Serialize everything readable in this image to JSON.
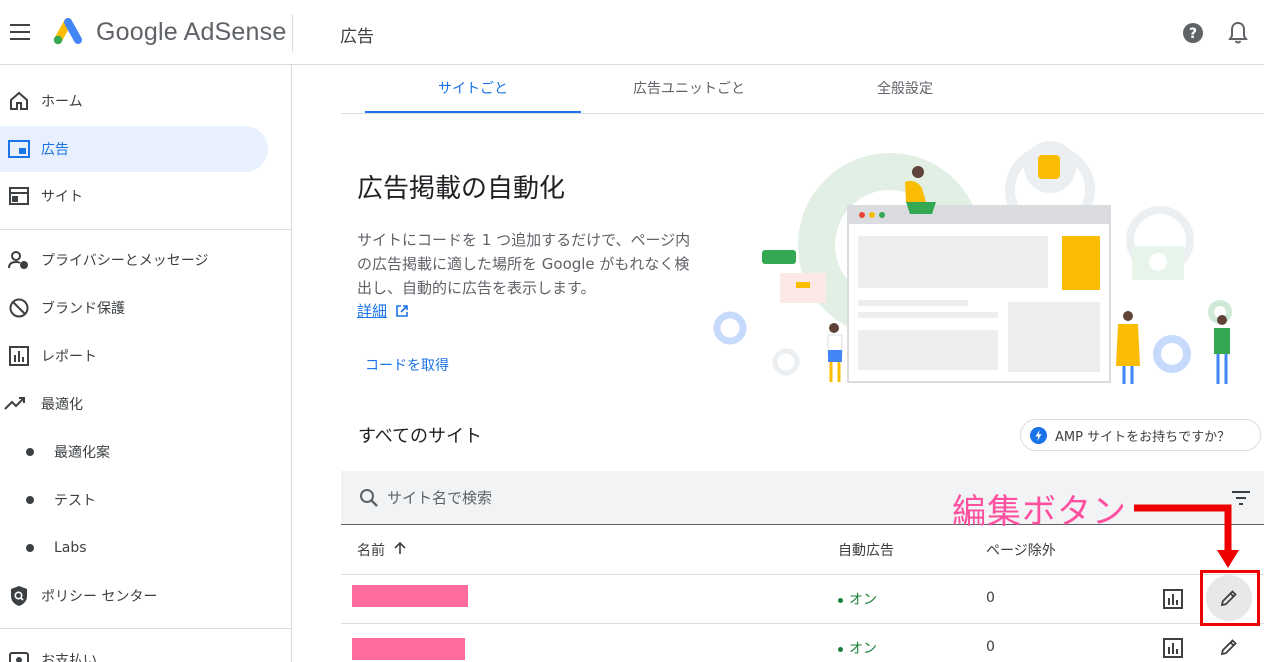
{
  "app": {
    "brand": "Google AdSense",
    "page_title": "広告"
  },
  "sidebar": {
    "items": [
      {
        "label": "ホーム",
        "icon": "home-icon"
      },
      {
        "label": "広告",
        "icon": "ads-icon",
        "active": true
      },
      {
        "label": "サイト",
        "icon": "sites-icon"
      },
      {
        "label": "プライバシーとメッセージ",
        "icon": "privacy-icon"
      },
      {
        "label": "ブランド保護",
        "icon": "block-icon"
      },
      {
        "label": "レポート",
        "icon": "reports-icon"
      },
      {
        "label": "最適化",
        "icon": "trending-up-icon"
      },
      {
        "label": "最適化案",
        "sub": true
      },
      {
        "label": "テスト",
        "sub": true
      },
      {
        "label": "Labs",
        "sub": true
      },
      {
        "label": "ポリシー センター",
        "icon": "policy-shield-icon"
      },
      {
        "label": "お支払い",
        "icon": "payments-icon"
      }
    ]
  },
  "tabs": [
    {
      "label": "サイトごと",
      "active": true
    },
    {
      "label": "広告ユニットごと"
    },
    {
      "label": "全般設定"
    }
  ],
  "hero": {
    "title": "広告掲載の自動化",
    "description": "サイトにコードを 1 つ追加するだけで、ページ内の広告掲載に適した場所を Google がもれなく検出し、自動的に広告を表示します。",
    "details_link": "詳細",
    "get_code": "コードを取得"
  },
  "sites_section": {
    "title": "すべてのサイト",
    "amp_chip": "AMP サイトをお持ちですか？",
    "search_placeholder": "サイト名で検索",
    "columns": {
      "name": "名前",
      "auto_ads": "自動広告",
      "page_exclusion": "ページ除外"
    },
    "rows": [
      {
        "auto_ads": "オン",
        "page_exclusion": "0"
      },
      {
        "auto_ads": "オン",
        "page_exclusion": "0"
      }
    ]
  },
  "annotation": {
    "text": "編集ボタン",
    "color": "#ff4fa0",
    "box_color": "#ee0000"
  },
  "colors": {
    "accent": "#1a73e8",
    "active_bg": "#e8f0fe",
    "status_green": "#188038",
    "redaction": "#ff6b9e"
  }
}
